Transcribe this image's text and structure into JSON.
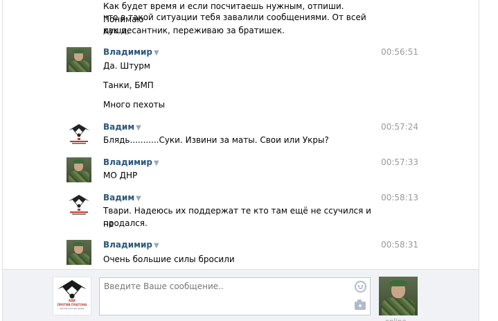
{
  "messages": [
    {
      "author": "",
      "time": "",
      "avatar": "logo",
      "lines": [
        "Как будет время и если посчитаешь нужным, отпиши. Понимаю",
        "что в такой ситуации тебя завалили сообщениями. От всей души,",
        "как десантник, переживаю за братишек."
      ]
    },
    {
      "author": "Владимир",
      "time": "00:56:51",
      "avatar": "soldier",
      "lines": [
        "Да. Штурм",
        "Танки, БМП",
        "Много пехоты"
      ]
    },
    {
      "author": "Вадим",
      "time": "00:57:24",
      "avatar": "logo",
      "lines": [
        "Блядь...........Суки. Извини за маты. Свои или Укры?"
      ]
    },
    {
      "author": "Владимир",
      "time": "00:57:33",
      "avatar": "soldier",
      "lines": [
        "МО ДНР"
      ]
    },
    {
      "author": "Вадим",
      "time": "00:58:13",
      "avatar": "logo",
      "lines": [
        "Твари. Надеюсь их поддержат те кто там ещё не ссучился и не",
        "продался."
      ]
    },
    {
      "author": "Владимир",
      "time": "00:58:31",
      "avatar": "soldier",
      "lines": [
        "Очень большие силы бросили"
      ]
    }
  ],
  "caret": "▼",
  "logo_text": {
    "top": "ВДВ",
    "main": "ПРОТИВ ПЛАТОНА",
    "sub": "против платных дорог"
  },
  "compose": {
    "placeholder": "Введите Ваше сообщение..",
    "value": "",
    "smile_icon": "smile-icon",
    "camera_icon": "camera-icon"
  },
  "status": {
    "peer": "online"
  },
  "colors": {
    "author": "#2b587a",
    "time": "#999999",
    "compose_bg": "#f0f2f5"
  }
}
